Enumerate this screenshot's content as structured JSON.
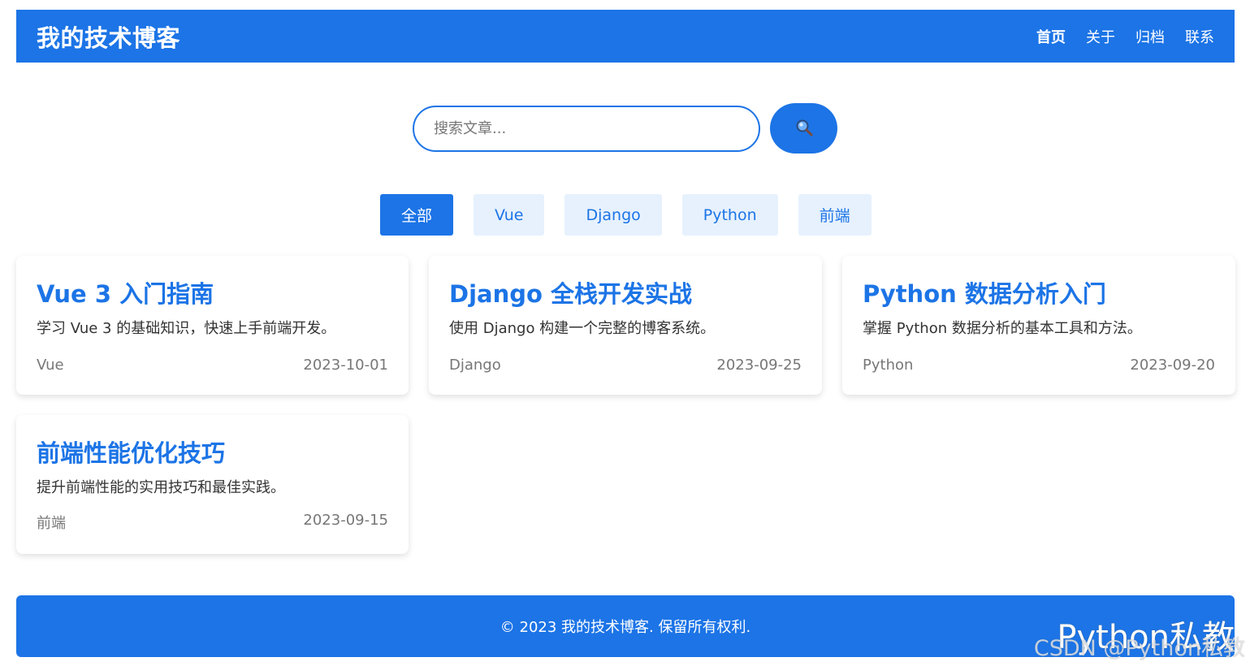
{
  "header": {
    "title": "我的技术博客",
    "nav": [
      "首页",
      "关于",
      "归档",
      "联系"
    ],
    "active_nav": "首页"
  },
  "search": {
    "placeholder": "搜索文章...",
    "value": "",
    "button_icon": "magnifier-icon"
  },
  "filters": {
    "items": [
      "全部",
      "Vue",
      "Django",
      "Python",
      "前端"
    ],
    "active": "全部"
  },
  "posts": [
    {
      "title": "Vue 3 入门指南",
      "desc": "学习 Vue 3 的基础知识，快速上手前端开发。",
      "tag": "Vue",
      "date": "2023-10-01"
    },
    {
      "title": "Django 全栈开发实战",
      "desc": "使用 Django 构建一个完整的博客系统。",
      "tag": "Django",
      "date": "2023-09-25"
    },
    {
      "title": "Python 数据分析入门",
      "desc": "掌握 Python 数据分析的基本工具和方法。",
      "tag": "Python",
      "date": "2023-09-20"
    },
    {
      "title": "前端性能优化技巧",
      "desc": "提升前端性能的实用技巧和最佳实践。",
      "tag": "前端",
      "date": "2023-09-15"
    }
  ],
  "footer": {
    "text": "© 2023 我的技术博客. 保留所有权利."
  },
  "watermark": {
    "large": "Python私教",
    "small": "CSDN @Python私教"
  },
  "colors": {
    "primary": "#1c74e6",
    "filter_bg": "#e6f1fd",
    "muted_text": "#777777"
  }
}
